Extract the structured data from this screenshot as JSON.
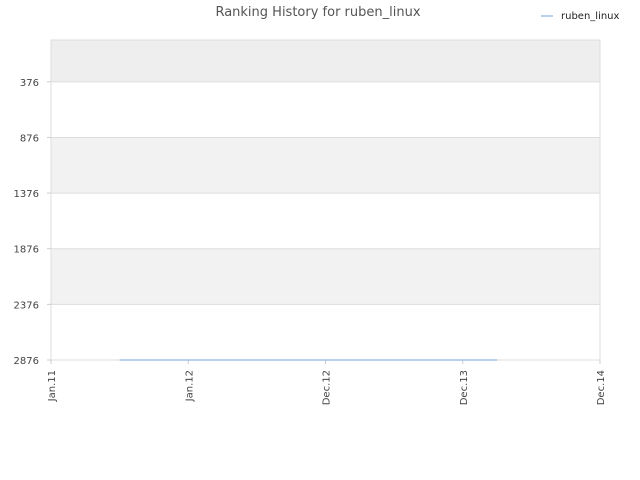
{
  "chart_data": {
    "type": "line",
    "title": "Ranking History for ruben_linux",
    "xlabel": "",
    "ylabel": "",
    "x_ticks": [
      "Jan.11",
      "Jan.12",
      "Dec.12",
      "Dec.13",
      "Dec.14"
    ],
    "y_ticks": [
      "376",
      "876",
      "1376",
      "1876",
      "2376",
      "2876"
    ],
    "ylim": [
      2876,
      0
    ],
    "y_inverted": true,
    "grid": true,
    "legend_position": "top-right",
    "series": [
      {
        "name": "ruben_linux",
        "color": "#9cc3e6",
        "points": [
          {
            "x": "Jul.11",
            "y": 2876
          },
          {
            "x": "Mar.14",
            "y": 2876
          }
        ]
      }
    ]
  }
}
